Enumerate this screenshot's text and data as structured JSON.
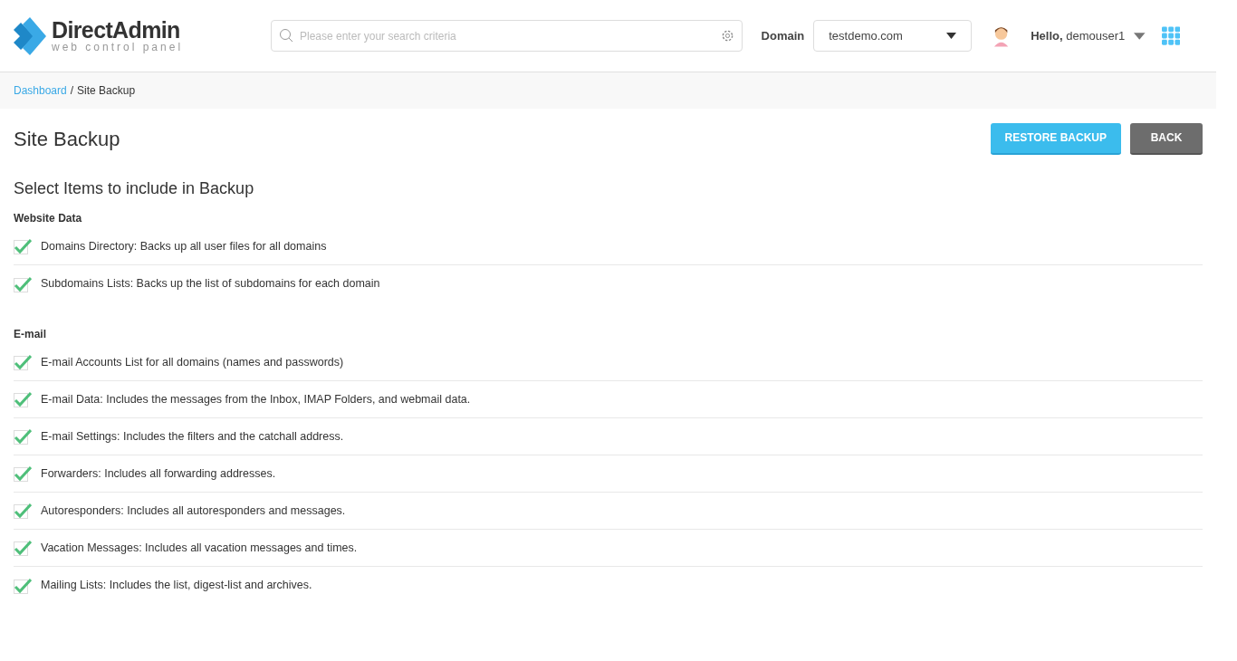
{
  "logo": {
    "name": "DirectAdmin",
    "tagline": "web control panel"
  },
  "search": {
    "placeholder": "Please enter your search criteria"
  },
  "domain": {
    "label": "Domain",
    "value": "testdemo.com"
  },
  "user": {
    "greeting": "**Hello,** demouser1"
  },
  "breadcrumb_separator": "/",
  "breadcrumb": [
    {
      "label": "Dashboard",
      "kind": "link"
    },
    {
      "label": "Site Backup",
      "kind": "current"
    }
  ],
  "page_title": "Site Backup",
  "buttons": [
    {
      "label": "RESTORE BACKUP",
      "kind": "primary"
    },
    {
      "label": "BACK",
      "kind": "secondary"
    }
  ],
  "section_title": "Select Items to include in Backup",
  "groups": [
    {
      "title": "Website Data",
      "items": [
        {
          "label": "Domains Directory: Backs up all user files for all domains",
          "checked": true
        },
        {
          "label": "Subdomains Lists: Backs up the list of subdomains for each domain",
          "checked": true
        }
      ]
    },
    {
      "title": "E-mail",
      "items": [
        {
          "label": "E-mail Accounts List for all domains (names and passwords)",
          "checked": true
        },
        {
          "label": "E-mail Data: Includes the messages from the Inbox, IMAP Folders, and webmail data.",
          "checked": true
        },
        {
          "label": "E-mail Settings: Includes the filters and the catchall address.",
          "checked": true
        },
        {
          "label": "Forwarders: Includes all forwarding addresses.",
          "checked": true
        },
        {
          "label": "Autoresponders: Includes all autoresponders and messages.",
          "checked": true
        },
        {
          "label": "Vacation Messages: Includes all vacation messages and times.",
          "checked": true
        },
        {
          "label": "Mailing Lists: Includes the list, digest-list and archives.",
          "checked": true
        }
      ]
    }
  ]
}
